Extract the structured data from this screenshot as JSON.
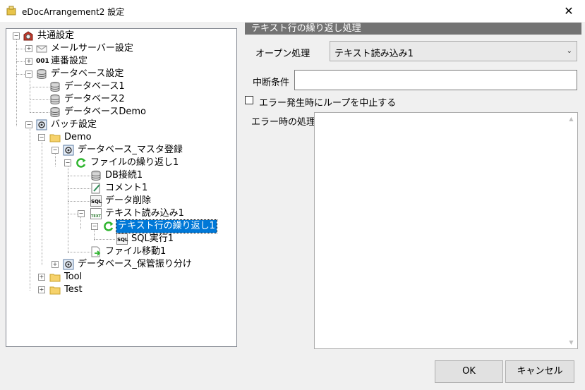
{
  "window": {
    "title": "eDocArrangement2 設定",
    "close_glyph": "✕"
  },
  "tree": {
    "nodes": [
      {
        "label": "共通設定",
        "icon": "gear-box-icon"
      },
      {
        "label": "メールサーバー設定",
        "icon": "envelope-icon"
      },
      {
        "label": "連番設定",
        "icon": "numbering-icon",
        "icon_text": "001"
      },
      {
        "label": "データベース設定",
        "icon": "database-icon"
      },
      {
        "label": "データベース1",
        "icon": "database-icon"
      },
      {
        "label": "データベース2",
        "icon": "database-icon"
      },
      {
        "label": "データベースDemo",
        "icon": "database-icon"
      },
      {
        "label": "バッチ設定",
        "icon": "batch-icon"
      },
      {
        "label": "Demo",
        "icon": "folder-icon"
      },
      {
        "label": "データベース_マスタ登録",
        "icon": "batch-icon"
      },
      {
        "label": "ファイルの繰り返し1",
        "icon": "loop-icon"
      },
      {
        "label": "DB接続1",
        "icon": "database-icon"
      },
      {
        "label": "コメント1",
        "icon": "comment-icon"
      },
      {
        "label": "データ削除",
        "icon": "sql-icon",
        "icon_text": "SQL"
      },
      {
        "label": "テキスト読み込み1",
        "icon": "text-file-icon",
        "icon_text": "TEXT"
      },
      {
        "label": "テキスト行の繰り返し1",
        "icon": "loop-icon",
        "selected": true
      },
      {
        "label": "SQL実行1",
        "icon": "sql-icon",
        "icon_text": "SQL"
      },
      {
        "label": "ファイル移動1",
        "icon": "file-move-icon"
      },
      {
        "label": "データベース_保管振り分け",
        "icon": "batch-icon"
      },
      {
        "label": "Tool",
        "icon": "folder-icon"
      },
      {
        "label": "Test",
        "icon": "folder-icon"
      }
    ]
  },
  "panel": {
    "header": "テキスト行の繰り返し処理",
    "open_label": "オープン処理",
    "open_value": "テキスト読み込み1",
    "stop_label": "中断条件",
    "stop_value": "",
    "checkbox_label": "エラー発生時にループを中止する",
    "checkbox_checked": false,
    "error_label": "エラー時の処理",
    "error_value": ""
  },
  "buttons": {
    "ok": "OK",
    "cancel": "キャンセル"
  },
  "colors": {
    "selection": "#0078d7",
    "header_bg": "#737373",
    "window_bg": "#f0f0f0",
    "loop_green": "#2fb52f"
  }
}
